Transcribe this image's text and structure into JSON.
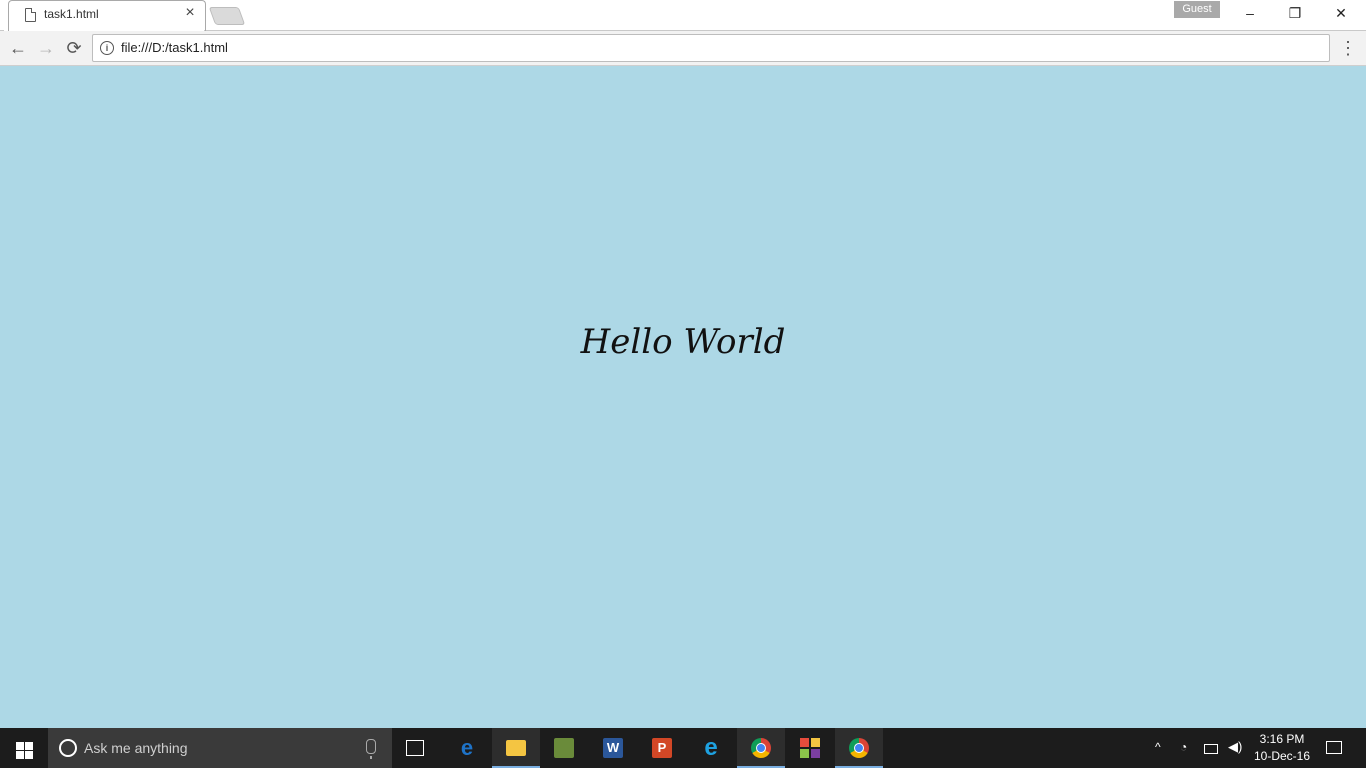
{
  "browser": {
    "tab_title": "task1.html",
    "tab_close_glyph": "×",
    "profile_badge": "Guest",
    "window_buttons": {
      "minimize": "–",
      "restore": "❐",
      "close": "✕"
    },
    "url": "file:///D:/task1.html",
    "info_glyph": "i",
    "back_glyph": "←",
    "forward_glyph": "→",
    "reload_glyph": "⟳",
    "menu_glyph": "⋮"
  },
  "page": {
    "background_color": "#add8e6",
    "heading": "Hello World"
  },
  "taskbar": {
    "search_placeholder": "Ask me anything",
    "apps": [
      {
        "name": "task-view",
        "icon": "task-view-icon"
      },
      {
        "name": "edge",
        "icon": "edge-icon",
        "label": "e",
        "color": "#1e73c8"
      },
      {
        "name": "file-explorer",
        "icon": "folder-icon",
        "color": "#f4c542"
      },
      {
        "name": "minecraft",
        "icon": "minecraft-icon",
        "color": "#6a8b3a"
      },
      {
        "name": "word",
        "icon": "word-icon",
        "label": "W",
        "color": "#2b579a"
      },
      {
        "name": "powerpoint",
        "icon": "powerpoint-icon",
        "label": "P",
        "color": "#d24726"
      },
      {
        "name": "internet-explorer",
        "icon": "ie-icon",
        "label": "e",
        "color": "#1ea1e0"
      },
      {
        "name": "chrome",
        "icon": "chrome-icon"
      },
      {
        "name": "office",
        "icon": "office-icon"
      },
      {
        "name": "chrome-active",
        "icon": "chrome-icon"
      }
    ],
    "tray": {
      "chevron": "^",
      "wifi_glyph": "◔",
      "volume_glyph": "◀)"
    },
    "time": "3:16 PM",
    "date": "10-Dec-16"
  }
}
